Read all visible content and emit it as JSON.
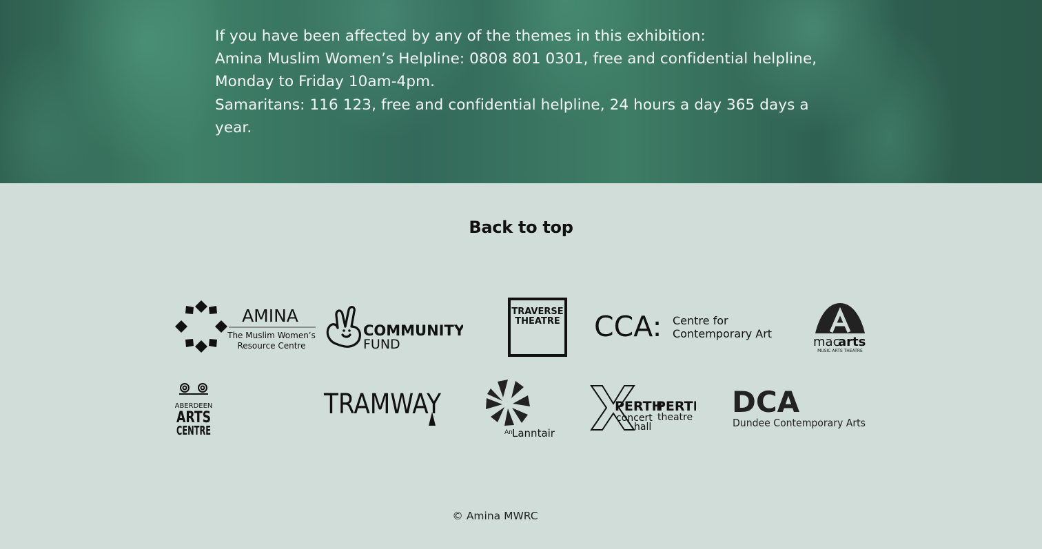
{
  "helpline": {
    "intro": "If you have been affected by any of the themes in this exhibition:",
    "amina_line": "Amina Muslim Women’s Helpline: 0808 801 0301, free and confidential helpline, Monday to Friday 10am-4pm.",
    "samaritans_line": "Samaritans: 116 123, free and confidential helpline, 24 hours a day 365 days a year."
  },
  "back_to_top_label": "Back to top",
  "logos": {
    "amina": {
      "name": "AMINA",
      "line1": "The Muslim Women’s",
      "line2": "Resource Centre"
    },
    "community_fund": {
      "line1": "COMMUNITY",
      "line2": "FUND"
    },
    "traverse": {
      "line1": "TRAVERSE",
      "line2": "THEATRE"
    },
    "cca": {
      "mark": "CCA:",
      "line1": "Centre for",
      "line2": "Contemporary Arts"
    },
    "macarts": {
      "mac": "mac",
      "arts": "arts",
      "tagline": "MUSIC ARTS THEATRE"
    },
    "aberdeen": {
      "line1": "ABERDEEN",
      "line2": "ARTS",
      "line3": "CENTRE"
    },
    "tramway": {
      "text": "TRAMWAY"
    },
    "lanntair": {
      "prefix": "An",
      "name": "Lanntair"
    },
    "perth": {
      "left_title": "PERTH",
      "left_sub1": "concert",
      "left_sub2": "hall",
      "right_title": "PERTH",
      "right_sub": "theatre"
    },
    "dca": {
      "mark": "DCA",
      "name": "Dundee Contemporary Arts"
    }
  },
  "copyright": "© Amina MWRC"
}
